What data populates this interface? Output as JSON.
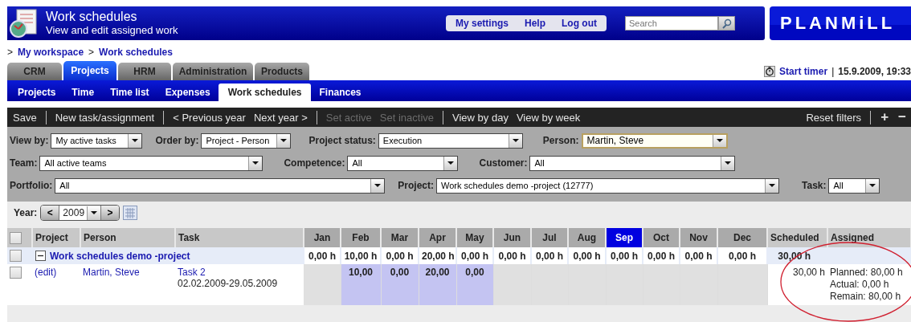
{
  "header": {
    "title": "Work schedules",
    "subtitle": "View and edit assigned work",
    "links": [
      "My settings",
      "Help",
      "Log out"
    ],
    "search": {
      "placeholder": "Search"
    },
    "logo": "PLANMiLL"
  },
  "breadcrumb": [
    {
      "kind": "sep",
      "text": ">"
    },
    {
      "kind": "link",
      "text": "My workspace"
    },
    {
      "kind": "sep",
      "text": ">"
    },
    {
      "kind": "link",
      "text": "Work schedules"
    }
  ],
  "tabs": [
    {
      "label": "CRM",
      "selected": false
    },
    {
      "label": "Projects",
      "selected": true
    },
    {
      "label": "HRM",
      "selected": false
    },
    {
      "label": "Administration",
      "selected": false
    },
    {
      "label": "Products",
      "selected": false
    }
  ],
  "timer": {
    "label": "Start timer",
    "separator": "|",
    "datetime": "15.9.2009, 19:33"
  },
  "subtabs": [
    {
      "label": "Projects",
      "selected": false
    },
    {
      "label": "Time",
      "selected": false
    },
    {
      "label": "Time list",
      "selected": false
    },
    {
      "label": "Expenses",
      "selected": false
    },
    {
      "label": "Work schedules",
      "selected": true
    },
    {
      "label": "Finances",
      "selected": false
    }
  ],
  "toolbar": [
    {
      "kind": "button",
      "label": "Save",
      "disabled": false
    },
    {
      "kind": "separator"
    },
    {
      "kind": "button",
      "label": "New task/assignment",
      "disabled": false
    },
    {
      "kind": "separator"
    },
    {
      "kind": "button",
      "label": "< Previous year",
      "disabled": false
    },
    {
      "kind": "button",
      "label": "Next year >",
      "disabled": false
    },
    {
      "kind": "separator"
    },
    {
      "kind": "button",
      "label": "Set active",
      "disabled": true
    },
    {
      "kind": "button",
      "label": "Set inactive",
      "disabled": true
    },
    {
      "kind": "separator"
    },
    {
      "kind": "button",
      "label": "View by day",
      "disabled": false
    },
    {
      "kind": "button",
      "label": "View by week",
      "disabled": false
    },
    {
      "kind": "spacer"
    },
    {
      "kind": "button",
      "label": "Reset filters",
      "disabled": false
    },
    {
      "kind": "separator"
    },
    {
      "kind": "button",
      "label": "+",
      "disabled": false
    },
    {
      "kind": "button",
      "label": "−",
      "disabled": false
    }
  ],
  "filters": [
    [
      {
        "label": "View by:",
        "value": "My active tasks",
        "focused": false
      },
      {
        "label": "Order by:",
        "value": "Project - Person",
        "focused": false
      },
      {
        "label": "Project status:",
        "value": "Execution",
        "focused": false
      },
      {
        "label": "Person:",
        "value": "Martin, Steve",
        "focused": true
      }
    ],
    [
      {
        "label": "Team:",
        "value": "All active teams",
        "focused": false
      },
      {
        "label": "Competence:",
        "value": "All",
        "focused": false
      },
      {
        "label": "Customer:",
        "value": "All",
        "focused": false
      }
    ],
    [
      {
        "label": "Portfolio:",
        "value": "All",
        "focused": false
      },
      {
        "label": "Project:",
        "value": "Work schedules demo -project (12777)",
        "focused": false
      },
      {
        "label": "Task:",
        "value": "All",
        "focused": false
      }
    ]
  ],
  "year": {
    "label": "Year:",
    "prev": "<",
    "value": "2009",
    "next": ">"
  },
  "table": {
    "select_all": {
      "checked": false
    },
    "columns": [
      {
        "kind": "text",
        "label": "Project",
        "current": false
      },
      {
        "kind": "text",
        "label": "Person",
        "current": false
      },
      {
        "kind": "text",
        "label": "Task",
        "current": false
      },
      {
        "kind": "month",
        "label": "Jan",
        "current": false
      },
      {
        "kind": "month",
        "label": "Feb",
        "current": false
      },
      {
        "kind": "month",
        "label": "Mar",
        "current": false
      },
      {
        "kind": "month",
        "label": "Apr",
        "current": false
      },
      {
        "kind": "month",
        "label": "May",
        "current": false
      },
      {
        "kind": "month",
        "label": "Jun",
        "current": false
      },
      {
        "kind": "month",
        "label": "Jul",
        "current": false
      },
      {
        "kind": "month",
        "label": "Aug",
        "current": false
      },
      {
        "kind": "month",
        "label": "Sep",
        "current": true
      },
      {
        "kind": "month",
        "label": "Oct",
        "current": false
      },
      {
        "kind": "month",
        "label": "Nov",
        "current": false
      },
      {
        "kind": "month",
        "label": "Dec",
        "current": false
      },
      {
        "kind": "total",
        "label": "Scheduled",
        "current": false
      },
      {
        "kind": "total",
        "label": "Assigned",
        "current": false
      }
    ],
    "group": {
      "checked": false,
      "expanded": true,
      "name": "Work schedules demo -project",
      "totals": [
        "0,00 h",
        "10,00 h",
        "0,00 h",
        "20,00 h",
        "0,00 h",
        "0,00 h",
        "0,00 h",
        "0,00 h",
        "0,00 h",
        "0,00 h",
        "0,00 h",
        "0,00 h"
      ],
      "scheduled": "30,00 h"
    },
    "rows": [
      {
        "checked": false,
        "project": "(edit)",
        "person": "Martin, Steve",
        "task": "Task 2",
        "dates": "02.02.2009-29.05.2009",
        "months": [
          {
            "active": false
          },
          {
            "value": "10,00",
            "active": true
          },
          {
            "value": "0,00",
            "active": true
          },
          {
            "value": "20,00",
            "active": true
          },
          {
            "value": "0,00",
            "active": true
          },
          {
            "active": false
          },
          {
            "active": false
          },
          {
            "active": false
          },
          {
            "active": false
          },
          {
            "active": false
          },
          {
            "active": false
          },
          {
            "active": false
          }
        ],
        "scheduled": "30,00 h",
        "assigned": [
          "Planned: 80,00 h",
          "Actual: 0,00 h",
          "Remain: 80,00 h"
        ]
      }
    ]
  }
}
